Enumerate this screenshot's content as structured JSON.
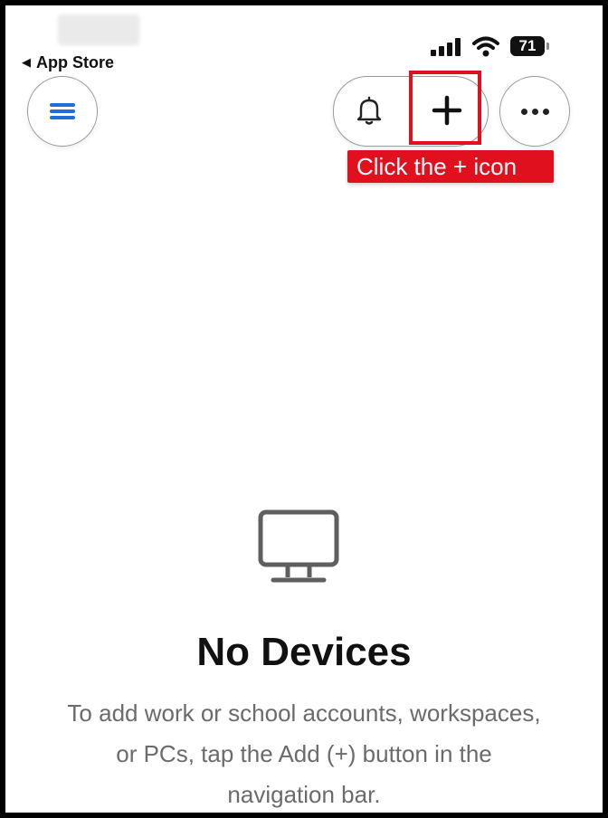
{
  "status_bar": {
    "battery_level": "71",
    "signal_icon": "cellular-signal-icon",
    "wifi_icon": "wifi-icon"
  },
  "nav": {
    "back_label": "App Store",
    "menu_icon": "hamburger-menu-icon",
    "notifications_icon": "bell-icon",
    "add_icon": "plus-icon",
    "more_icon": "ellipsis-icon"
  },
  "annotation": {
    "callout_text": "Click the + icon",
    "color": "#e0101e"
  },
  "empty_state": {
    "icon": "monitor-icon",
    "title": "No Devices",
    "description": "To add work or school accounts, workspaces, or PCs, tap the Add (+) button in the navigation bar."
  },
  "colors": {
    "accent": "#1f6fd6",
    "muted_text": "#6b6b6b"
  }
}
